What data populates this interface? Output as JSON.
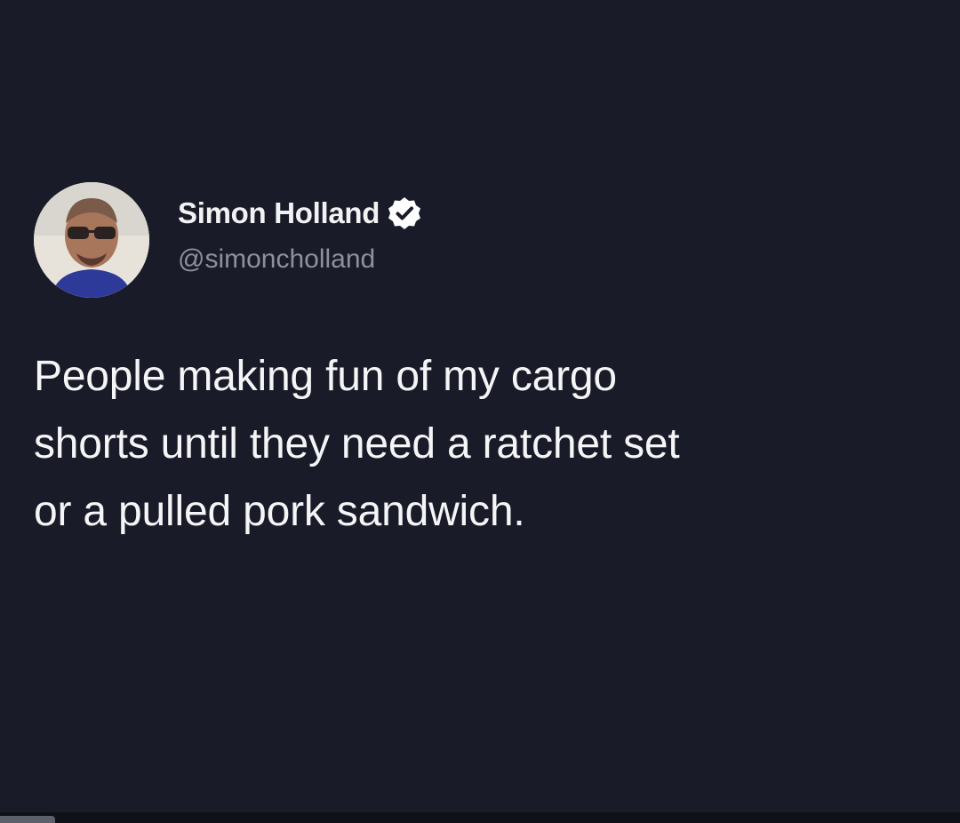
{
  "tweet": {
    "author": {
      "display_name": "Simon Holland",
      "handle": "@simoncholland",
      "verified": true,
      "avatar_icon": "profile-photo-icon"
    },
    "text": "People making fun of my cargo\nshorts until they need a ratchet set\nor a pulled pork sandwich."
  },
  "colors": {
    "background": "#191c28",
    "text_primary": "#f5f5f7",
    "text_secondary": "#8d919c",
    "verified_badge": "#ffffff"
  }
}
